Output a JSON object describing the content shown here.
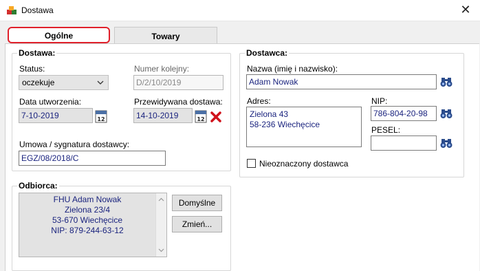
{
  "window": {
    "title": "Dostawa",
    "close_glyph": "✕"
  },
  "tabs": [
    {
      "label": "Ogólne",
      "active": true
    },
    {
      "label": "Towary",
      "active": false
    }
  ],
  "delivery": {
    "group_title": "Dostawa:",
    "status_label": "Status:",
    "status_value": "oczekuje",
    "number_label": "Numer kolejny:",
    "number_value": "D/2/10/2019",
    "created_label": "Data utworzenia:",
    "created_value": "7-10-2019",
    "planned_label": "Przewidywana dostawa:",
    "planned_value": "14-10-2019",
    "contract_label": "Umowa / sygnatura dostawcy:",
    "contract_value": "EGZ/08/2018/C"
  },
  "supplier": {
    "group_title": "Dostawca:",
    "name_label": "Nazwa (imię i nazwisko):",
    "name_value": "Adam Nowak",
    "address_label": "Adres:",
    "address_line1": "Zielona 43",
    "address_line2": "58-236 Wiechęcice",
    "nip_label": "NIP:",
    "nip_value": "786-804-20-98",
    "pesel_label": "PESEL:",
    "pesel_value": "",
    "unmarked_label": "Nieoznaczony dostawca"
  },
  "recipient": {
    "group_title": "Odbiorca:",
    "lines": [
      "FHU Adam Nowak",
      "Zielona 23/4",
      "53-670 Wiechęcice",
      "NIP: 879-244-63-12"
    ],
    "default_button": "Domyślne",
    "change_button": "Zmień..."
  },
  "icons": {
    "app": "app-cubes-icon",
    "calendar": "calendar-icon",
    "delete": "delete-x-icon",
    "search": "binoculars-icon",
    "dropdown": "chevron-down-icon"
  },
  "colors": {
    "active_tab_border": "#e0202a",
    "field_text": "#1a237e",
    "delete_icon": "#d0121b"
  }
}
